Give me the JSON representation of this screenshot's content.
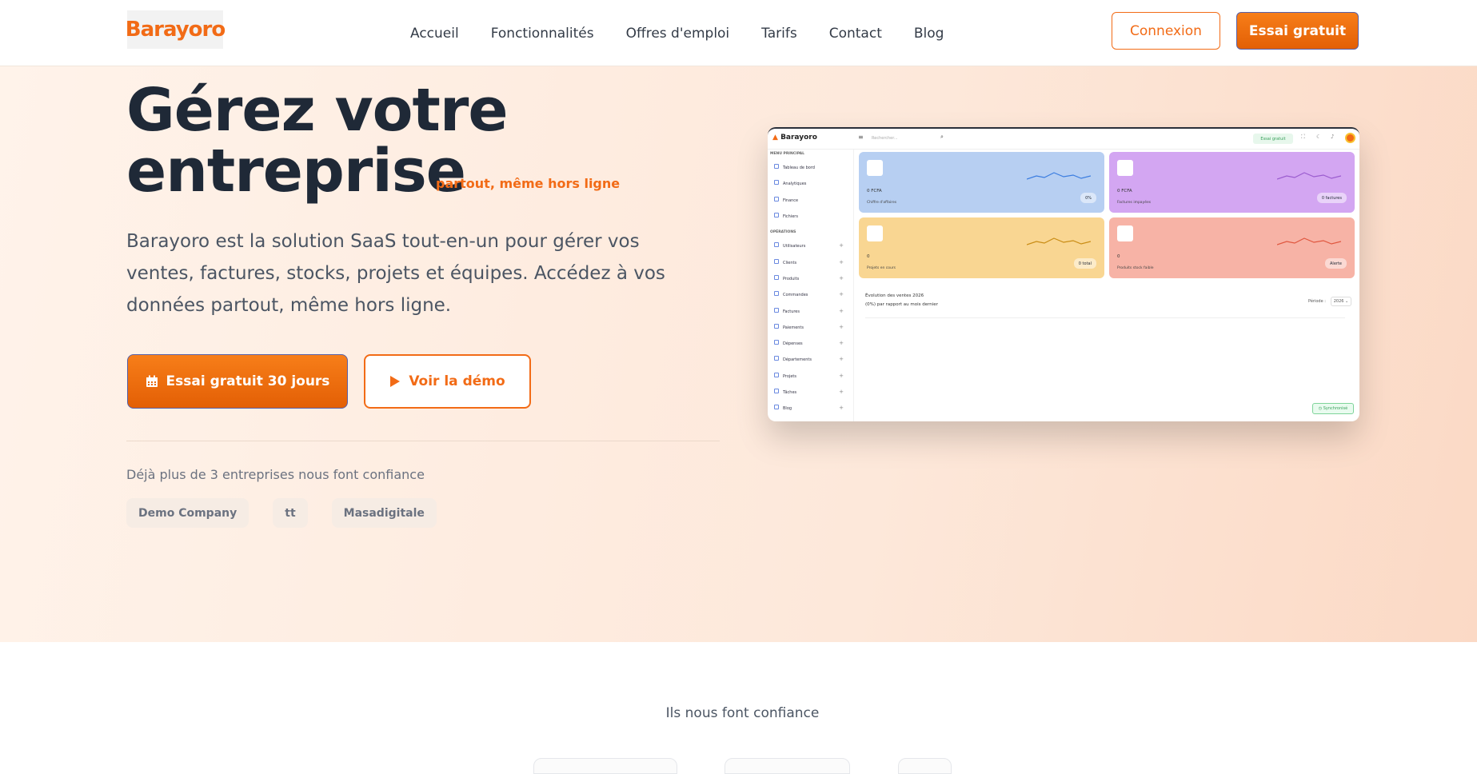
{
  "header": {
    "logo_text": "Barayoro",
    "nav": [
      "Accueil",
      "Fonctionnalités",
      "Offres d'emploi",
      "Tarifs",
      "Contact",
      "Blog"
    ],
    "login_label": "Connexion",
    "trial_label": "Essai gratuit"
  },
  "hero": {
    "title_line1": "Gérez votre",
    "title_line2": "entreprise",
    "tagline": "partout, même hors ligne",
    "description": "Barayoro est la solution SaaS tout-en-un pour gérer vos ventes, factures, stocks, projets et équipes. Accédez à vos données partout, même hors ligne.",
    "cta_primary": "Essai gratuit 30 jours",
    "cta_secondary": "Voir la démo",
    "trust_text": "Déjà plus de 3 entreprises nous font confiance",
    "companies": [
      "Demo Company",
      "tt",
      "Masadigitale"
    ]
  },
  "mockup": {
    "brand": "Barayoro",
    "search_placeholder": "Rechercher...",
    "essai_badge": "Essai gratuit",
    "menu_principal": "MENU PRINCIPAL",
    "menu_items": [
      "Tableau de bord",
      "Analytiques",
      "Finance",
      "Fichiers"
    ],
    "operations": "OPÉRATIONS",
    "operation_items": [
      "Utilisateurs",
      "Clients",
      "Produits",
      "Commandes",
      "Factures",
      "Paiements",
      "Dépenses",
      "Départements",
      "Projets",
      "Tâches",
      "Blog"
    ],
    "cards": [
      {
        "value": "0 FCFA",
        "label": "Chiffre d'affaires",
        "badge": "0%",
        "color": "#b7cff2",
        "line": "#3b7de0"
      },
      {
        "value": "0 FCFA",
        "label": "Factures impayées",
        "badge": "0 factures",
        "color": "#d3a6f2",
        "line": "#9b5ccf"
      },
      {
        "value": "0",
        "label": "Projets en cours",
        "badge": "0 total",
        "color": "#f9d692",
        "line": "#c98c14"
      },
      {
        "value": "0",
        "label": "Produits stock faible",
        "badge": "Alerte",
        "color": "#f7b3a6",
        "line": "#e0573f"
      }
    ],
    "sales_title": "Évolution des ventes 2026",
    "sales_sub": "(0%) par rapport au mois dernier",
    "period_label": "Période :",
    "period_value": "2026",
    "sync_label": "Synchronisé"
  },
  "section2": {
    "title": "Ils nous font confiance"
  },
  "colors": {
    "accent": "#f26b16",
    "text_dark": "#1f2937"
  }
}
